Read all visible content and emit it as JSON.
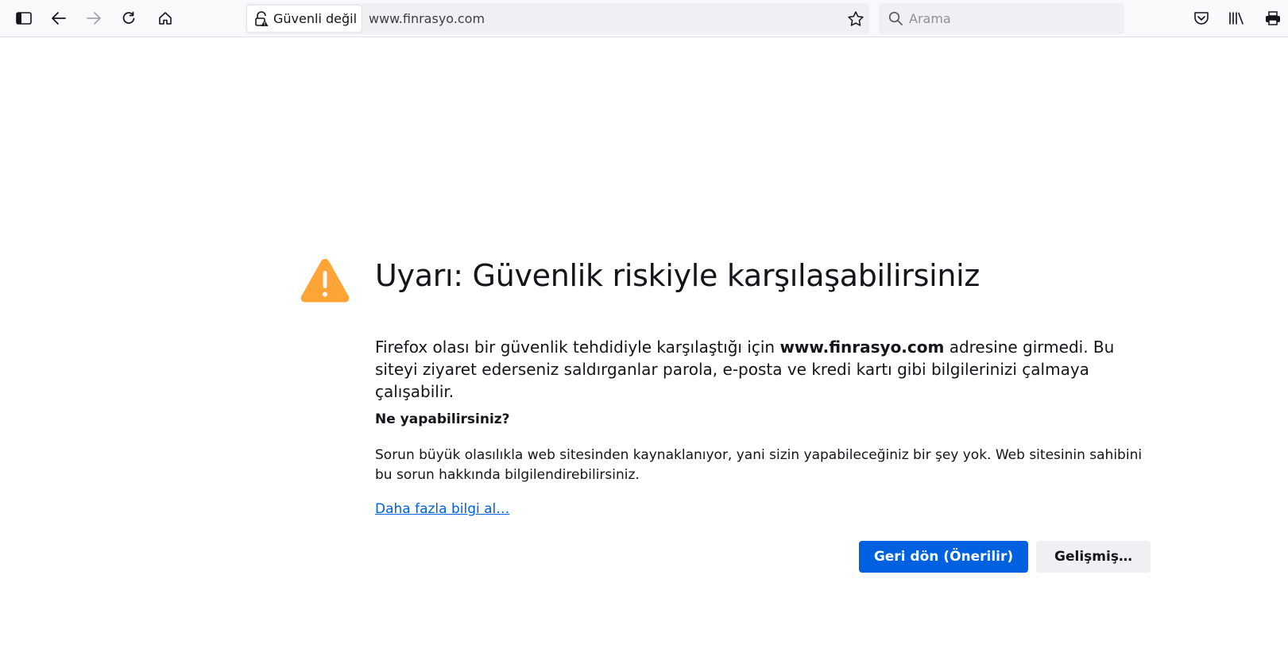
{
  "toolbar": {
    "sidebar_icon": "sidebar-icon",
    "back_icon": "back-arrow-icon",
    "forward_icon": "forward-arrow-icon",
    "reload_icon": "reload-icon",
    "home_icon": "home-icon",
    "pocket_icon": "pocket-icon",
    "library_icon": "library-icon",
    "print_icon": "print-icon"
  },
  "urlbar": {
    "identity_label": "Güvenli değil",
    "url": "www.finrasyo.com",
    "lock_icon": "insecure-lock-icon",
    "bookmark_icon": "star-icon"
  },
  "searchbar": {
    "placeholder": "Arama",
    "icon": "search-icon"
  },
  "error_page": {
    "icon": "warning-icon",
    "icon_color": "#ffa436",
    "title": "Uyarı: Güvenlik riskiyle karşılaşabilirsiniz",
    "desc_part1": "Firefox olası bir güvenlik tehdidiyle karşılaştığı için ",
    "desc_domain": "www.finrasyo.com",
    "desc_part2": " adresine girmedi. Bu siteyi ziyaret ederseniz saldırganlar parola, e-posta ve kredi kartı gibi bilgilerinizi çalmaya çalışabilir.",
    "what_title": "Ne yapabilirsiniz?",
    "what_body": "Sorun büyük olasılıkla web sitesinden kaynaklanıyor, yani sizin yapabileceğiniz bir şey yok. Web sitesinin sahibini bu sorun hakkında bilgilendirebilirsiniz.",
    "learn_more": "Daha fazla bilgi al…",
    "primary_button": "Geri dön (Önerilir)",
    "secondary_button": "Gelişmiş…",
    "primary_color": "#0061e0"
  }
}
